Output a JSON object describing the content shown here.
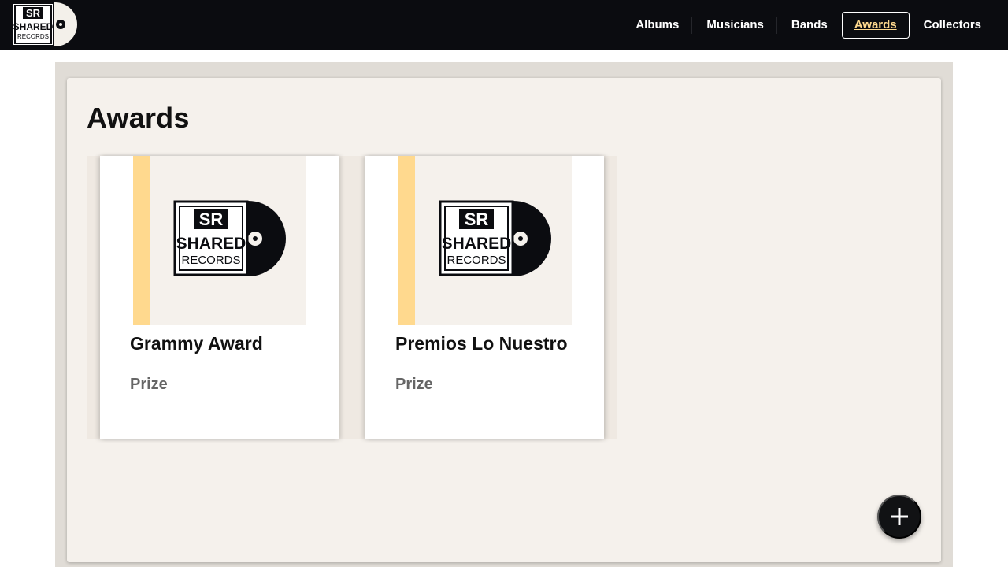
{
  "brand": {
    "logo_line1": "SR",
    "logo_line2": "SHARED",
    "logo_line3": "RECORDS"
  },
  "nav": {
    "items": [
      {
        "label": "Albums",
        "active": false
      },
      {
        "label": "Musicians",
        "active": false
      },
      {
        "label": "Bands",
        "active": false
      },
      {
        "label": "Awards",
        "active": true
      },
      {
        "label": "Collectors",
        "active": false
      }
    ]
  },
  "page": {
    "title": "Awards"
  },
  "awards": [
    {
      "name": "Grammy Award",
      "type": "Prize"
    },
    {
      "name": "Premios Lo Nuestro",
      "type": "Prize"
    }
  ],
  "fab": {
    "icon": "plus-icon"
  },
  "colors": {
    "navbar": "#0b0c10",
    "accent": "#ffd98e",
    "panel": "#f5f1ec",
    "outer": "#e0dcd6"
  }
}
